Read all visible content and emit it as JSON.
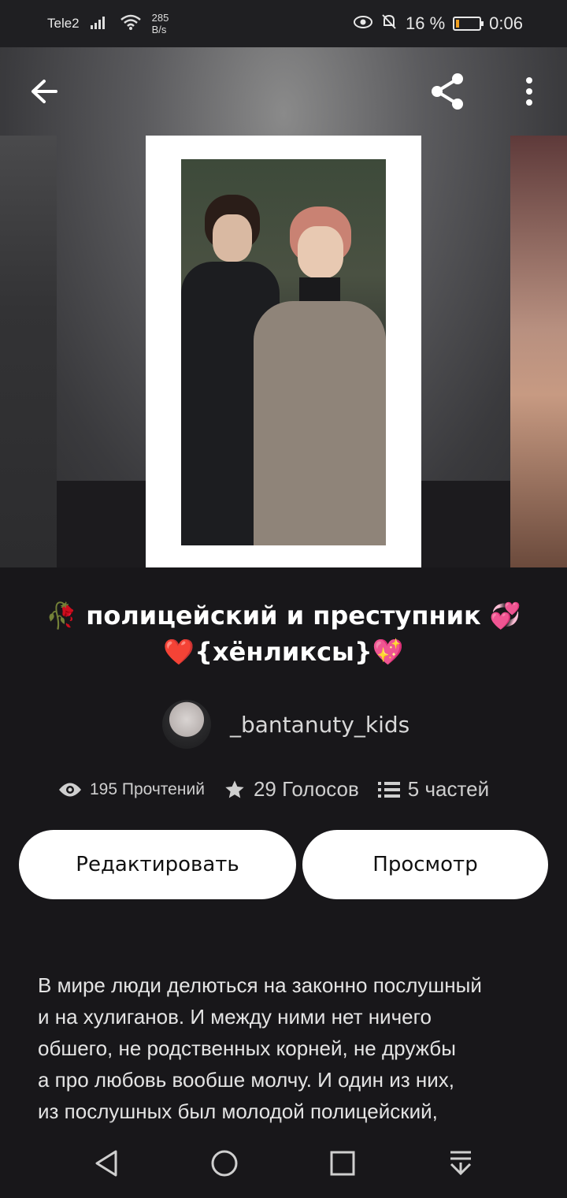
{
  "status_bar": {
    "carrier": "Tele2",
    "net_speed_value": "285",
    "net_speed_unit": "B/s",
    "battery_percent": "16 %",
    "battery_level": 0.16,
    "time": "0:06"
  },
  "toolbar": {
    "back_icon": "arrow-left-icon",
    "share_icon": "share-icon",
    "more_icon": "more-vertical-icon"
  },
  "story": {
    "title_line1": "🥀 полицейский и преступник 💞",
    "title_line2": "❤️{хёнликсы}💖",
    "author": "_bantanuty_kids",
    "reads": "195 Прочтений",
    "votes": "29 Голосов",
    "parts": "5 частей",
    "description": "В мире люди делються на законно послушный\nи на хулиганов. И между ними нет ничего\nобшего, не родственных корней, не дружбы\nа про любовь вообше молчу. И один из них,\nиз послушных был молодой полицейский,"
  },
  "actions": {
    "edit_label": "Редактировать",
    "view_label": "Просмотр"
  },
  "colors": {
    "background": "#18171a",
    "button_bg": "#ffffff",
    "button_text": "#111111"
  }
}
